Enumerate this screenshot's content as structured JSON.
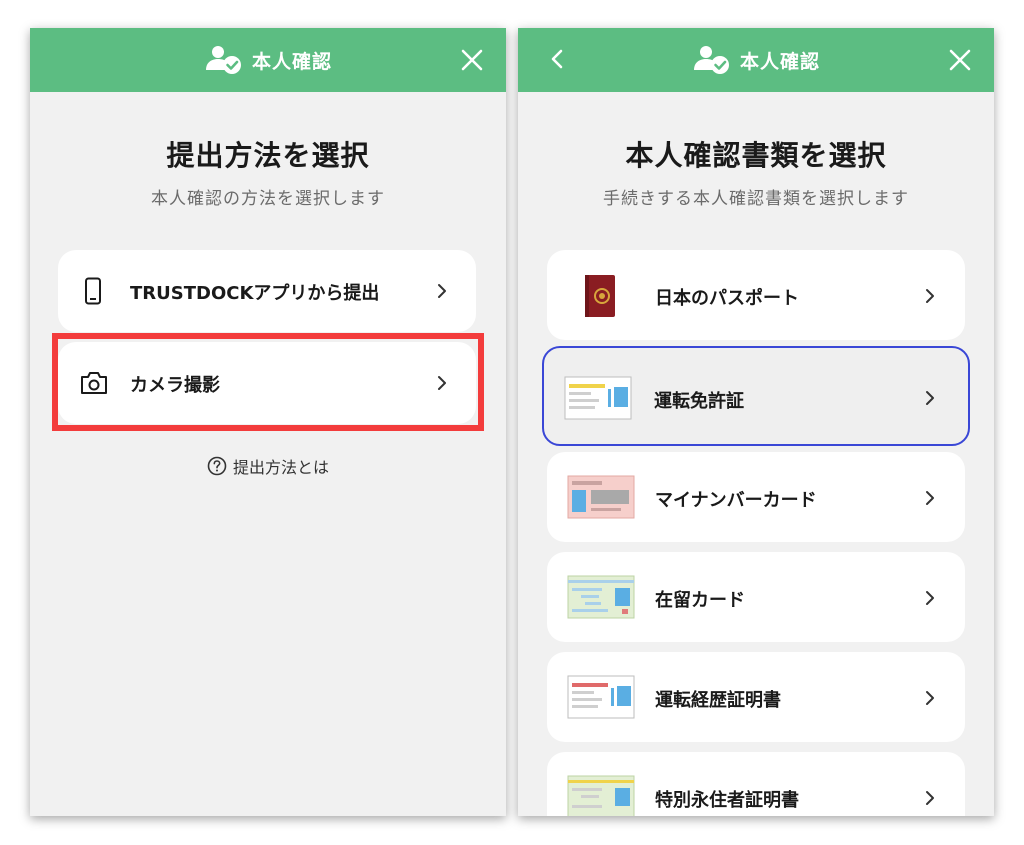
{
  "left": {
    "header": {
      "title": "本人確認"
    },
    "title": "提出方法を選択",
    "subtitle": "本人確認の方法を選択します",
    "options": [
      {
        "label": "TRUSTDOCKアプリから提出",
        "icon": "smartphone-icon"
      },
      {
        "label": "カメラ撮影",
        "icon": "camera-icon",
        "highlighted": true
      }
    ],
    "help_link": "提出方法とは"
  },
  "right": {
    "header": {
      "title": "本人確認"
    },
    "title": "本人確認書類を選択",
    "subtitle": "手続きする本人確認書類を選択します",
    "documents": [
      {
        "label": "日本のパスポート",
        "icon": "passport-icon"
      },
      {
        "label": "運転免許証",
        "icon": "drivers-license-icon",
        "selected": true
      },
      {
        "label": "マイナンバーカード",
        "icon": "my-number-card-icon"
      },
      {
        "label": "在留カード",
        "icon": "residence-card-icon"
      },
      {
        "label": "運転経歴証明書",
        "icon": "driving-history-certificate-icon"
      },
      {
        "label": "特別永住者証明書",
        "icon": "special-permanent-resident-certificate-icon"
      }
    ]
  },
  "colors": {
    "header_green": "#5cbd82",
    "highlight_red": "#f33c3c",
    "selected_border": "#3a47d6",
    "background": "#f1f1f1"
  }
}
